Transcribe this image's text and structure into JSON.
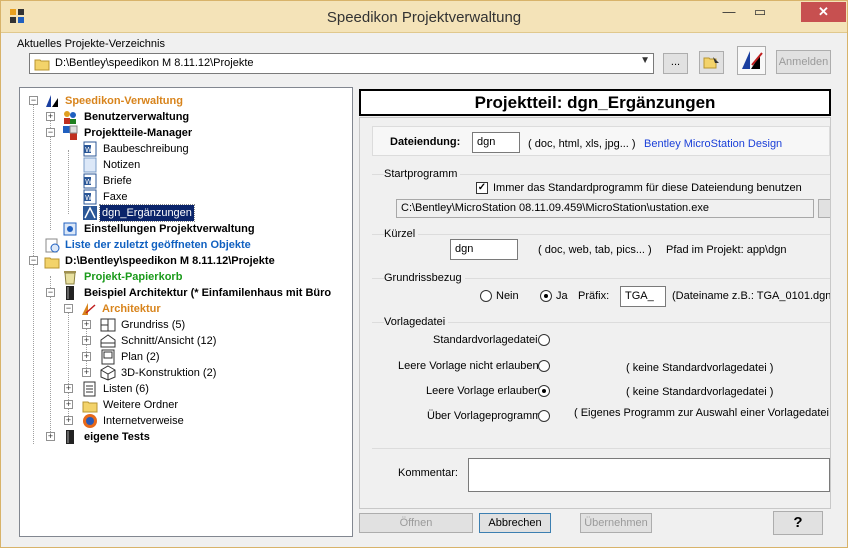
{
  "window": {
    "title": "Speedikon Projektverwaltung",
    "minimize": "—",
    "maximize": "▭",
    "close": "✕"
  },
  "top": {
    "dir_label": "Aktuelles Projekte-Verzeichnis",
    "dir_value": "D:\\Bentley\\speedikon M 8.11.12\\Projekte",
    "browse_label": "...",
    "anmelden_label": "Anmelden"
  },
  "tree": {
    "root": "Speedikon-Verwaltung",
    "benutzer": "Benutzerverwaltung",
    "projektteile": "Projektteile-Manager",
    "baubeschreibung": "Baubeschreibung",
    "notizen": "Notizen",
    "briefe": "Briefe",
    "faxe": "Faxe",
    "dgn": "dgn_Ergänzungen",
    "einstellungen": "Einstellungen Projektverwaltung",
    "liste": "Liste der zuletzt geöffneten Objekte",
    "projektpfad": "D:\\Bentley\\speedikon M 8.11.12\\Projekte",
    "papierkorb": "Projekt-Papierkorb",
    "beispiel": "Beispiel Architektur   (* Einfamilenhaus mit Büro",
    "architektur": "Architektur",
    "grundriss": "Grundriss (5)",
    "schnitt": "Schnitt/Ansicht (12)",
    "plan": "Plan (2)",
    "konstruktion": "3D-Konstruktion (2)",
    "listen": "Listen  (6)",
    "weitere": "Weitere Ordner",
    "internet": "Internetverweise",
    "eigene": "eigene Tests"
  },
  "panel": {
    "header": "Projektteil: dgn_Ergänzungen",
    "dateiendung_label": "Dateiendung:",
    "dateiendung_value": "dgn",
    "dateiendung_hint": "( doc, html, xls, jpg... )",
    "dateiendung_desc": "Bentley MicroStation Design",
    "startprogramm_title": "Startprogramm",
    "startprogramm_check": "Immer das Standardprogramm für diese Dateiendung benutzen",
    "startprogramm_path": "C:\\Bentley\\MicroStation 08.11.09.459\\MicroStation\\ustation.exe",
    "kuerzel_title": "Kürzel",
    "kuerzel_value": "dgn",
    "kuerzel_hint": "( doc, web, tab, pics... )",
    "kuerzel_path": "Pfad im Projekt: app\\dgn",
    "grundriss_title": "Grundrissbezug",
    "nein": "Nein",
    "ja": "Ja",
    "praefix_label": "Präfix:",
    "praefix_value": "TGA_",
    "praefix_hint": "(Dateiname z.B.: TGA_0101.dgn",
    "vorlage_title": "Vorlagedatei",
    "vorlage_standard": "Standardvorlagedatei",
    "vorlage_nicht": "Leere Vorlage nicht erlauben",
    "vorlage_nicht_hint": "( keine Standardvorlagedatei )",
    "vorlage_erlauben": "Leere Vorlage erlauben",
    "vorlage_erlauben_hint": "( keine Standardvorlagedatei )",
    "vorlage_programm": "Über Vorlageprogramm",
    "vorlage_programm_hint": "( Eigenes Programm zur Auswahl einer Vorlagedatei )",
    "kommentar_label": "Kommentar:"
  },
  "buttons": {
    "oeffnen": "Öffnen",
    "abbrechen": "Abbrechen",
    "uebernehmen": "Übernehmen",
    "help": "?"
  },
  "colors": {
    "titlebar": "#f4e3b8",
    "close": "#c75050",
    "root_orange": "#d8841c",
    "green": "#1a9a1a",
    "blue": "#1060c0",
    "selection": "#0a246a"
  }
}
